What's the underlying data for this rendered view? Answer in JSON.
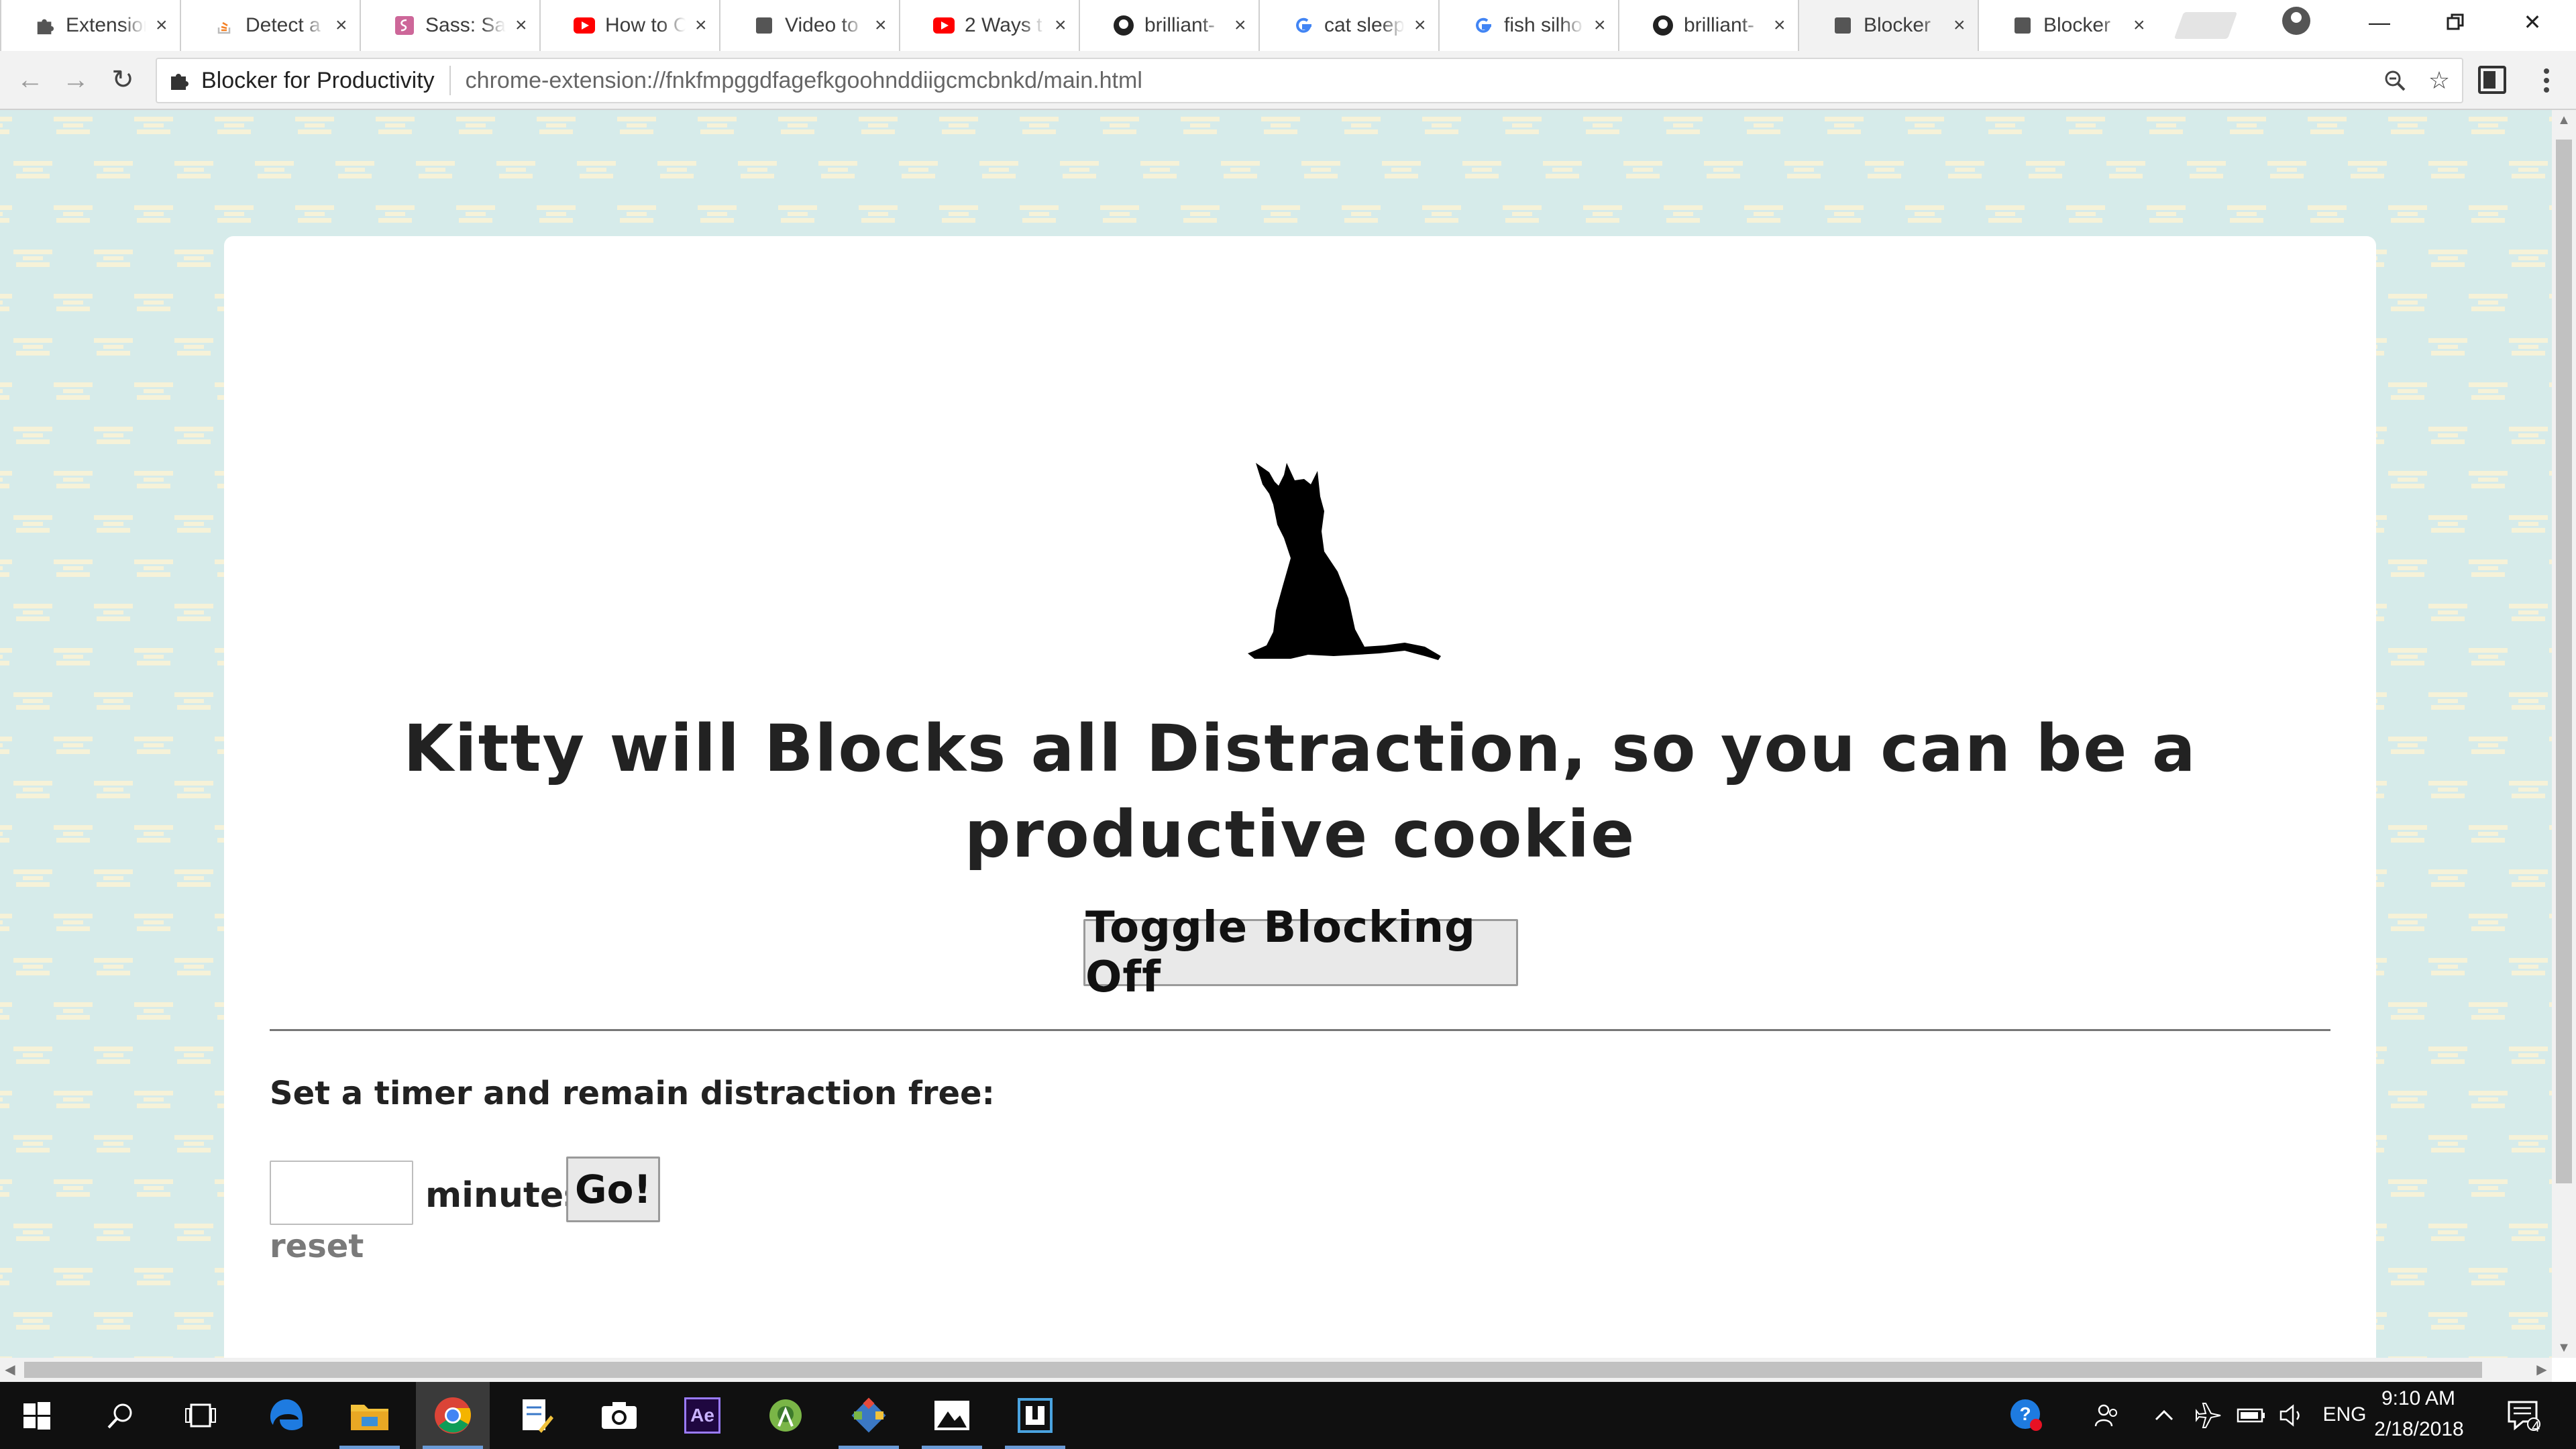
{
  "browser": {
    "tabs": [
      {
        "title": "Extensions",
        "icon": "puzzle-icon"
      },
      {
        "title": "Detect a",
        "icon": "stackoverflow-icon"
      },
      {
        "title": "Sass: Sass",
        "icon": "sass-icon"
      },
      {
        "title": "How to C",
        "icon": "youtube-icon"
      },
      {
        "title": "Video to",
        "icon": "video-icon"
      },
      {
        "title": "2 Ways t",
        "icon": "youtube-icon"
      },
      {
        "title": "brilliant-",
        "icon": "github-icon"
      },
      {
        "title": "cat sleep",
        "icon": "google-icon"
      },
      {
        "title": "fish silho",
        "icon": "google-icon"
      },
      {
        "title": "brilliant-",
        "icon": "github-icon"
      },
      {
        "title": "Blocker",
        "icon": "page-icon",
        "active": true
      },
      {
        "title": "Blocker",
        "icon": "page-icon"
      }
    ],
    "close_glyph": "×",
    "omnibox": {
      "site_name": "Blocker for Productivity",
      "url": "chrome-extension://fnkfmpggdfagefkgoohnddiigcmcbnkd/main.html"
    }
  },
  "page": {
    "headline": "Kitty will Blocks all Distraction, so you can be a productive cookie",
    "toggle_label": "Toggle Blocking Off",
    "timer_label": "Set a timer and remain distraction free:",
    "minutes_value": "",
    "minutes_label": "minutes",
    "go_label": "Go!",
    "reset_label": "reset",
    "background_color": "#d6ebea",
    "pattern_color": "#f6f2d8"
  },
  "taskbar": {
    "apps": [
      "start-icon",
      "search-icon",
      "task-view-icon",
      "edge-icon",
      "file-explorer-icon",
      "chrome-icon",
      "notepad-icon",
      "camera-icon",
      "after-effects-icon",
      "android-studio-icon",
      "git-icon",
      "photos-icon",
      "app-icon"
    ],
    "language": "ENG",
    "time": "9:10 AM",
    "date": "2/18/2018",
    "notification_count": "4",
    "ae_label": "Ae"
  }
}
